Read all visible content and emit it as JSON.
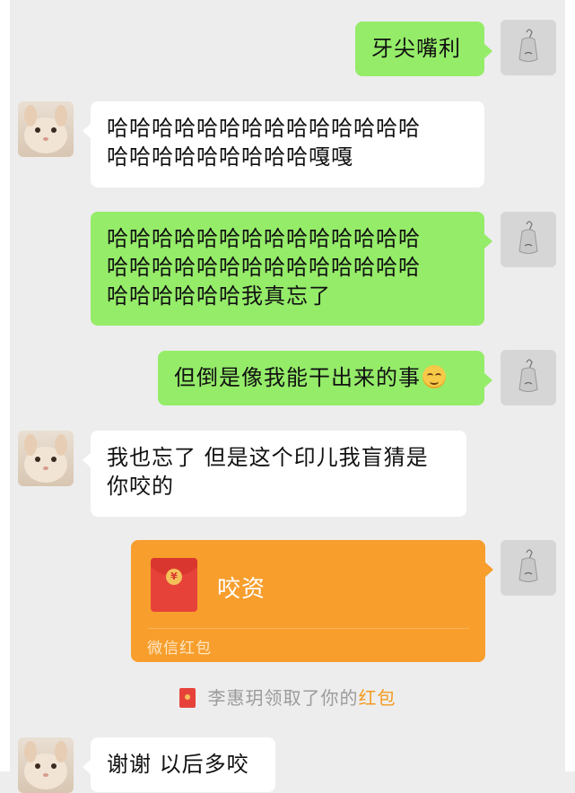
{
  "messages": [
    {
      "side": "out",
      "text": "牙尖嘴利"
    },
    {
      "side": "in",
      "lines": [
        "哈哈哈哈哈哈哈哈哈哈哈哈哈哈",
        "哈哈哈哈哈哈哈哈哈嘎嘎"
      ]
    },
    {
      "side": "out",
      "lines": [
        "哈哈哈哈哈哈哈哈哈哈哈哈哈哈",
        "哈哈哈哈哈哈哈哈哈哈哈哈哈哈",
        "哈哈哈哈哈哈我真忘了"
      ]
    },
    {
      "side": "out",
      "text": "但倒是像我能干出来的事",
      "emoji": "smiling-face-emoji"
    },
    {
      "side": "in",
      "lines": [
        "我也忘了 但是这个印儿我盲猜是",
        "你咬的"
      ]
    },
    {
      "side": "in",
      "text": "谢谢 以后多咬"
    }
  ],
  "red_packet": {
    "title": "咬资",
    "footer": "微信红包",
    "coin_symbol": "¥"
  },
  "system_notice": {
    "prefix": "李惠玥领取了你的",
    "highlight": "红包"
  },
  "colors": {
    "background": "#ededed",
    "outgoing_bubble": "#95ec69",
    "incoming_bubble": "#ffffff",
    "red_packet": "#f79e2d",
    "highlight": "#f39b1f"
  }
}
